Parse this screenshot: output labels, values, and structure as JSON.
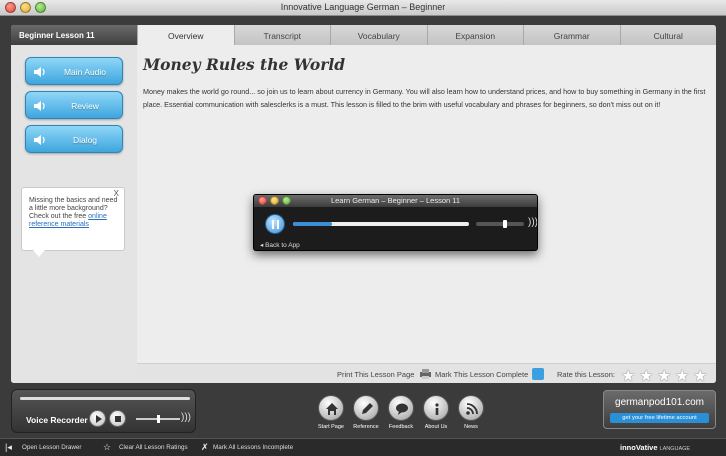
{
  "window": {
    "title": "Innovative Language German – Beginner"
  },
  "lesson_tab": "Beginner Lesson 11",
  "tabs": [
    "Overview",
    "Transcript",
    "Vocabulary",
    "Expansion",
    "Grammar",
    "Cultural"
  ],
  "active_tab": "Overview",
  "sidebar": {
    "buttons": [
      "Main Audio",
      "Review",
      "Dialog"
    ],
    "tip": {
      "close": "X",
      "text": "Missing the basics and need a little more background? Check out the free",
      "link": "online reference materials"
    }
  },
  "content": {
    "title": "Money Rules the World",
    "body": "Money makes the world go round... so join us to learn about currency in Germany. You will also learn how to understand prices, and how to buy something in Germany in the first place. Essential communication with salesclerks is a must. This lesson is filled to the brim with useful vocabulary and phrases for beginners, so don't miss out on it!"
  },
  "popup": {
    "title": "Learn German – Beginner – Lesson 11",
    "back": "◂ Back to App",
    "progress": 0.22,
    "volume": 0.6
  },
  "panel_footer": {
    "print": "Print This Lesson Page",
    "mark_complete": "Mark This Lesson Complete",
    "rate": "Rate this Lesson:",
    "stars": 5
  },
  "recorder": {
    "label": "Voice Recorder",
    "volume": 0.5
  },
  "nav": [
    {
      "label": "Start Page",
      "icon": "home-icon"
    },
    {
      "label": "Reference",
      "icon": "pencil-icon"
    },
    {
      "label": "Feedback",
      "icon": "speech-bubble-icon"
    },
    {
      "label": "About Us",
      "icon": "info-icon"
    },
    {
      "label": "News",
      "icon": "rss-icon"
    }
  ],
  "promo": {
    "site": "germanpod101.com",
    "cta": "get your free lifetime account"
  },
  "statusbar": {
    "open_drawer": "Open Lesson Drawer",
    "clear_ratings": "Clear All Lesson Ratings",
    "mark_incomplete": "Mark All Lessons Incomplete",
    "brand": "innoVative",
    "brand_sub": "LANGUAGE"
  }
}
